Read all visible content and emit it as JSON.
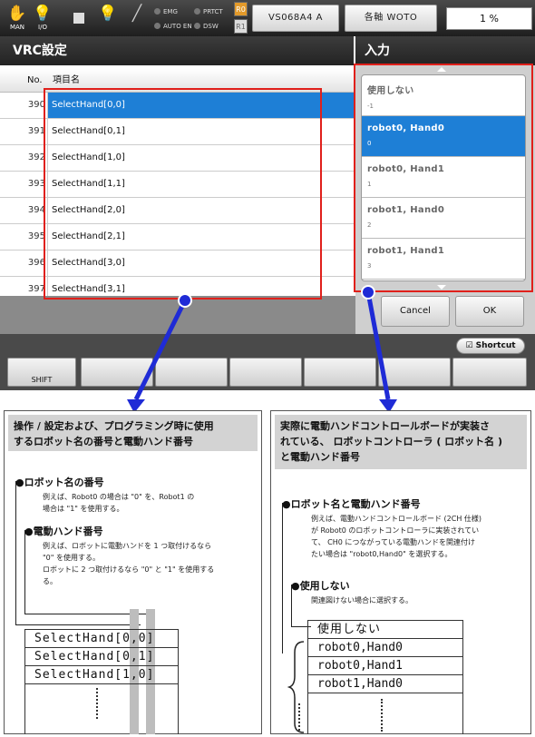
{
  "topbar": {
    "mode_label": "MAN",
    "io_label": "I/O",
    "leds": [
      "EMG",
      "PRTCT",
      "AUTO EN",
      "DSW"
    ],
    "r0": "R0",
    "r1": "R1",
    "program": "VS068A4 A",
    "axis": "各軸 WOTO",
    "progress": "1 %"
  },
  "left_panel": {
    "title": "VRC設定",
    "col_no": "No.",
    "col_name": "項目名",
    "rows": [
      {
        "no": "390",
        "name": "SelectHand[0,0]"
      },
      {
        "no": "391",
        "name": "SelectHand[0,1]"
      },
      {
        "no": "392",
        "name": "SelectHand[1,0]"
      },
      {
        "no": "393",
        "name": "SelectHand[1,1]"
      },
      {
        "no": "394",
        "name": "SelectHand[2,0]"
      },
      {
        "no": "395",
        "name": "SelectHand[2,1]"
      },
      {
        "no": "396",
        "name": "SelectHand[3,0]"
      },
      {
        "no": "397",
        "name": "SelectHand[3,1]"
      }
    ],
    "selected_index": 0
  },
  "right_panel": {
    "title": "入力",
    "options": [
      {
        "label": "使用しない",
        "value": "-1"
      },
      {
        "label": "robot0, Hand0",
        "value": "0"
      },
      {
        "label": "robot0, Hand1",
        "value": "1"
      },
      {
        "label": "robot1, Hand0",
        "value": "2"
      },
      {
        "label": "robot1, Hand1",
        "value": "3"
      }
    ],
    "selected_index": 1,
    "cancel": "Cancel",
    "ok": "OK"
  },
  "footer": {
    "shortcut": "Shortcut",
    "shift": "SHIFT"
  },
  "callout_left": {
    "heading_line1": "操作 / 設定および、プログラミング時に使用",
    "heading_line2": "するロボット名の番号と電動ハンド番号",
    "item1_title": "ロボット名の番号",
    "item1_text1": "例えば、Robot0 の場合は \"0\" を、Robot1 の",
    "item1_text2": "場合は \"1\" を使用する。",
    "item2_title": "電動ハンド番号",
    "item2_text1": "例えば、ロボットに電動ハンドを 1 つ取付けるなら",
    "item2_text2": "\"0\" を使用する。",
    "item2_text3": "ロボットに 2 つ取付けるなら \"0\" と \"1\" を使用する",
    "item2_text4": "る。",
    "table_rows": [
      "SelectHand[0,0]",
      "SelectHand[0,1]",
      "SelectHand[1,0]"
    ]
  },
  "callout_right": {
    "heading_line1": "実際に電動ハンドコントロールボードが実装さ",
    "heading_line2": "れている、 ロボットコントローラ ( ロボット名 )",
    "heading_line3": "と電動ハンド番号",
    "item1_title": "ロボット名と電動ハンド番号",
    "item1_text1": "例えば、電動ハンドコントロールボード (2CH 仕様)",
    "item1_text2": "が Robot0 のロボットコントローラに実装されてい",
    "item1_text3": "て、 CH0 につながっている電動ハンドを関連付け",
    "item1_text4": "たい場合は \"robot0,Hand0\" を選択する。",
    "item2_title": "使用しない",
    "item2_text1": "関連図けない場合に選択する。",
    "table_rows": [
      "使用しない",
      "robot0,Hand0",
      "robot0,Hand1",
      "robot1,Hand0"
    ]
  },
  "colors": {
    "accent": "#1e7fd6",
    "highlight": "#e0201b",
    "callout_arrow": "#1f2bd6"
  }
}
